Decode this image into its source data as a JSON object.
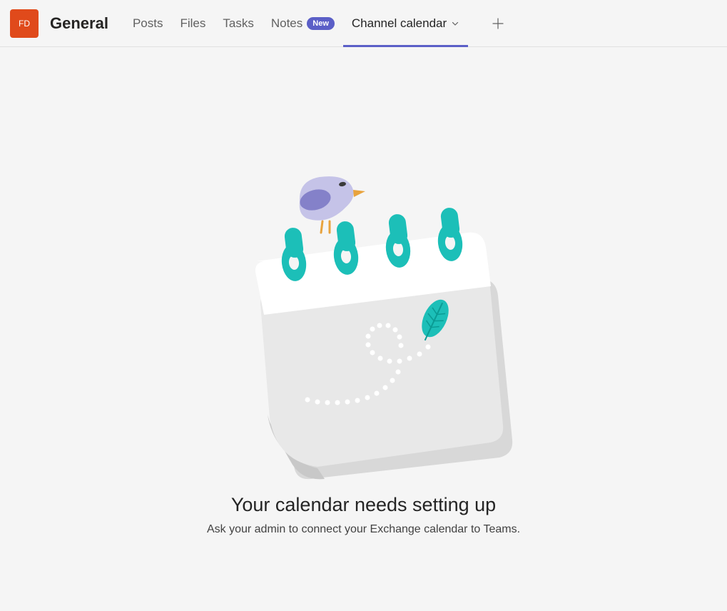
{
  "team": {
    "avatar_initials": "FD",
    "channel_name": "General"
  },
  "tabs": {
    "posts": "Posts",
    "files": "Files",
    "tasks": "Tasks",
    "notes": "Notes",
    "notes_badge": "New",
    "channel_calendar": "Channel calendar"
  },
  "empty_state": {
    "title": "Your calendar needs setting up",
    "subtitle": "Ask your admin to connect your Exchange calendar to Teams."
  }
}
